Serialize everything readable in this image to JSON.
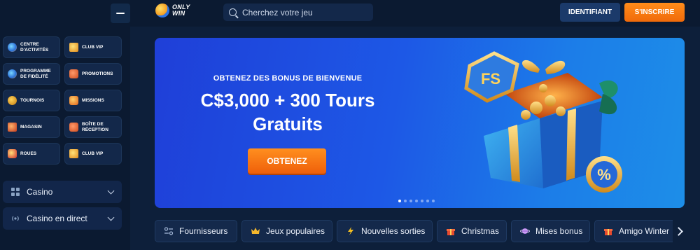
{
  "brand": {
    "line1": "ONLY",
    "line2": "WIN"
  },
  "search": {
    "placeholder": "Cherchez votre jeu"
  },
  "auth": {
    "login_label": "IDENTIFIANT",
    "signup_label": "S'INSCRIRE"
  },
  "sidebar": {
    "tiles": [
      {
        "label": "CENTRE D'ACTIVITÉS",
        "icon": "activity-center-icon"
      },
      {
        "label": "CLUB VIP",
        "icon": "crown-icon"
      },
      {
        "label": "PROGRAMME DE FIDÉLITÉ",
        "icon": "loyalty-icon"
      },
      {
        "label": "PROMOTIONS",
        "icon": "gift-icon"
      },
      {
        "label": "TOURNOIS",
        "icon": "trophy-icon"
      },
      {
        "label": "MISSIONS",
        "icon": "rocket-icon"
      },
      {
        "label": "MAGASIN",
        "icon": "shop-icon"
      },
      {
        "label": "BOÎTE DE RÉCEPTION",
        "icon": "inbox-gift-icon"
      },
      {
        "label": "ROUES",
        "icon": "wheel-icon"
      },
      {
        "label": "CLUB VIP",
        "icon": "crown-icon"
      }
    ],
    "menu": [
      {
        "label": "Casino",
        "icon": "grid-icon"
      },
      {
        "label": "Casino en direct",
        "icon": "live-icon"
      }
    ]
  },
  "banner": {
    "kicker": "OBTENEZ DES BONUS DE BIENVENUE",
    "headline_line1": "C$3,000 + 300 Tours",
    "headline_line2": "Gratuits",
    "cta": "OBTENEZ",
    "badge": "FS",
    "slides_total": 7,
    "active_slide": 1
  },
  "categories": [
    {
      "label": "Fournisseurs",
      "icon": "providers-icon"
    },
    {
      "label": "Jeux populaires",
      "icon": "crown-icon"
    },
    {
      "label": "Nouvelles sorties",
      "icon": "lightning-icon"
    },
    {
      "label": "Christmas",
      "icon": "gift-icon"
    },
    {
      "label": "Mises bonus",
      "icon": "planet-icon"
    },
    {
      "label": "Amigo Winter",
      "icon": "gift-icon"
    }
  ],
  "colors": {
    "accent_orange": "#f5780f",
    "primary_blue": "#1f4fe0",
    "bg_dark": "#0d1f3a"
  }
}
